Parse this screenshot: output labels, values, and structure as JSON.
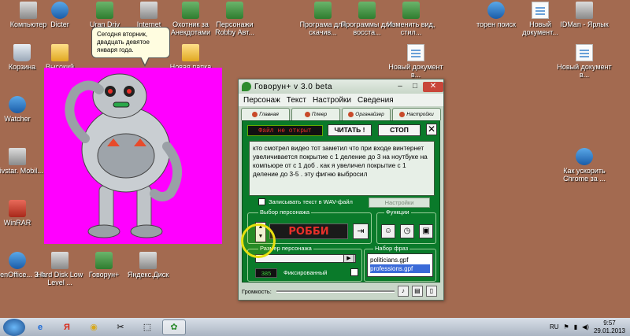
{
  "desktop_icons": [
    {
      "label": "Компьютер",
      "icon": "computer-icon"
    },
    {
      "label": "Dicter",
      "icon": "dicter-icon"
    },
    {
      "label": "Uran Driv",
      "icon": "uran-icon"
    },
    {
      "label": "Internet Downloa...",
      "icon": "download-icon"
    },
    {
      "label": "Охотник за Анекдотами",
      "icon": "app-icon"
    },
    {
      "label": "Персонажи Robby Авт...",
      "icon": "app-icon"
    },
    {
      "label": "Програма для скачив...",
      "icon": "app-icon"
    },
    {
      "label": "Программы для восста...",
      "icon": "app-icon"
    },
    {
      "label": "Изменить вид, стил...",
      "icon": "app-icon"
    },
    {
      "label": "торен поиск",
      "icon": "torrent-icon"
    },
    {
      "label": "Новый документ...",
      "icon": "document-icon"
    },
    {
      "label": "IDMan - Ярлык",
      "icon": "idm-icon"
    },
    {
      "label": "Корзина",
      "icon": "trash-icon"
    },
    {
      "label": "Высокий",
      "icon": "folder-icon"
    },
    {
      "label": "Новая папка",
      "icon": "folder-icon"
    },
    {
      "label": "Новый документ в...",
      "icon": "document-icon"
    },
    {
      "label": "Новый документ в...",
      "icon": "document-icon"
    },
    {
      "label": "Watcher",
      "icon": "watcher-icon"
    },
    {
      "label": "Kyivstar. Mobil...",
      "icon": "kyivstar-icon"
    },
    {
      "label": "Как ускорить Chrome за ...",
      "icon": "ie-icon"
    },
    {
      "label": "WinRAR",
      "icon": "winrar-icon"
    },
    {
      "label": "OpenOffice... 3.4",
      "icon": "openoffice-icon"
    },
    {
      "label": "Hard Disk Low Level ...",
      "icon": "harddisk-icon"
    },
    {
      "label": "Говорун+",
      "icon": "govorun-icon"
    },
    {
      "label": "Яндекс.Диск",
      "icon": "yandex-disk-icon"
    }
  ],
  "bubble": {
    "text": "Сегодня вторник, двадцать девятое января года."
  },
  "window": {
    "title": "Говорун+ v 3.0 beta",
    "menu": [
      "Персонаж",
      "Текст",
      "Настройки",
      "Сведения"
    ],
    "tabs": [
      "Главная",
      "Плеер",
      "Органайзер",
      "Настройки"
    ],
    "status": "Файл не открыт",
    "read_button": "ЧИТАТЬ !",
    "stop_button": "СТОП",
    "close_button": "✕",
    "text_content": "кто смотрел видео тот заметил что при входе винтернет увеличивается покрытие с 1 деление до 3 на ноутбуке на компьюре от с 1 доб . как я увеличел покрытие с 1 деление до 3-5 . эту фигню выбросил",
    "wav_checkbox_label": "Записывать текст в WAV-файл",
    "settings_button": "Настройки",
    "char_group_label": "Выбор персонажа",
    "char_name": "РОББИ",
    "functions_label": "Функции",
    "size_group_label": "Размер персонажа",
    "size_value": "385",
    "size_fraction": 0.88,
    "fixed_label": "Фиксированный",
    "phrases_label": "Набор фраз",
    "phrases": [
      "politicians.gpf",
      "professions.gpf"
    ],
    "selected_phrase": "professions.gpf",
    "volume_label": "Громкость:"
  },
  "taskbar": {
    "language": "RU",
    "time": "9:57",
    "date": "29.01.2013"
  }
}
